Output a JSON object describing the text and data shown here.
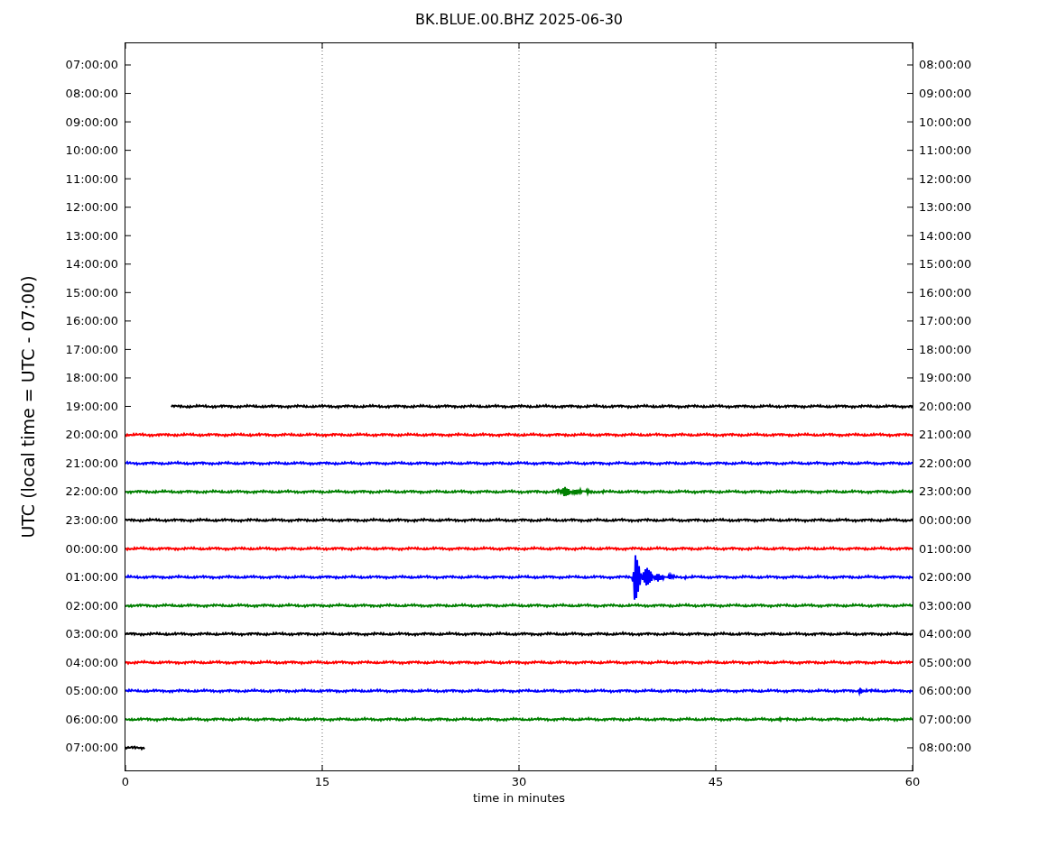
{
  "title": "BK.BLUE.00.BHZ 2025-06-30",
  "ylabel": "UTC (local time = UTC - 07:00)",
  "xlabel": "time in minutes",
  "xticks": [
    "0",
    "15",
    "30",
    "45",
    "60"
  ],
  "rows": [
    {
      "utc": "07:00:00",
      "local": "08:00:00"
    },
    {
      "utc": "08:00:00",
      "local": "09:00:00"
    },
    {
      "utc": "09:00:00",
      "local": "10:00:00"
    },
    {
      "utc": "10:00:00",
      "local": "11:00:00"
    },
    {
      "utc": "11:00:00",
      "local": "12:00:00"
    },
    {
      "utc": "12:00:00",
      "local": "13:00:00"
    },
    {
      "utc": "13:00:00",
      "local": "14:00:00"
    },
    {
      "utc": "14:00:00",
      "local": "15:00:00"
    },
    {
      "utc": "15:00:00",
      "local": "16:00:00"
    },
    {
      "utc": "16:00:00",
      "local": "17:00:00"
    },
    {
      "utc": "17:00:00",
      "local": "18:00:00"
    },
    {
      "utc": "18:00:00",
      "local": "19:00:00"
    },
    {
      "utc": "19:00:00",
      "local": "20:00:00",
      "color": "#000000"
    },
    {
      "utc": "20:00:00",
      "local": "21:00:00",
      "color": "#ff0000"
    },
    {
      "utc": "21:00:00",
      "local": "22:00:00",
      "color": "#0000ff"
    },
    {
      "utc": "22:00:00",
      "local": "23:00:00",
      "color": "#008000"
    },
    {
      "utc": "23:00:00",
      "local": "00:00:00",
      "color": "#000000"
    },
    {
      "utc": "00:00:00",
      "local": "01:00:00",
      "color": "#ff0000"
    },
    {
      "utc": "01:00:00",
      "local": "02:00:00",
      "color": "#0000ff"
    },
    {
      "utc": "02:00:00",
      "local": "03:00:00",
      "color": "#008000"
    },
    {
      "utc": "03:00:00",
      "local": "04:00:00",
      "color": "#000000"
    },
    {
      "utc": "04:00:00",
      "local": "05:00:00",
      "color": "#ff0000"
    },
    {
      "utc": "05:00:00",
      "local": "06:00:00",
      "color": "#0000ff"
    },
    {
      "utc": "06:00:00",
      "local": "07:00:00",
      "color": "#008000"
    },
    {
      "utc": "07:00:00",
      "local": "08:00:00",
      "color": "#000000"
    }
  ]
}
